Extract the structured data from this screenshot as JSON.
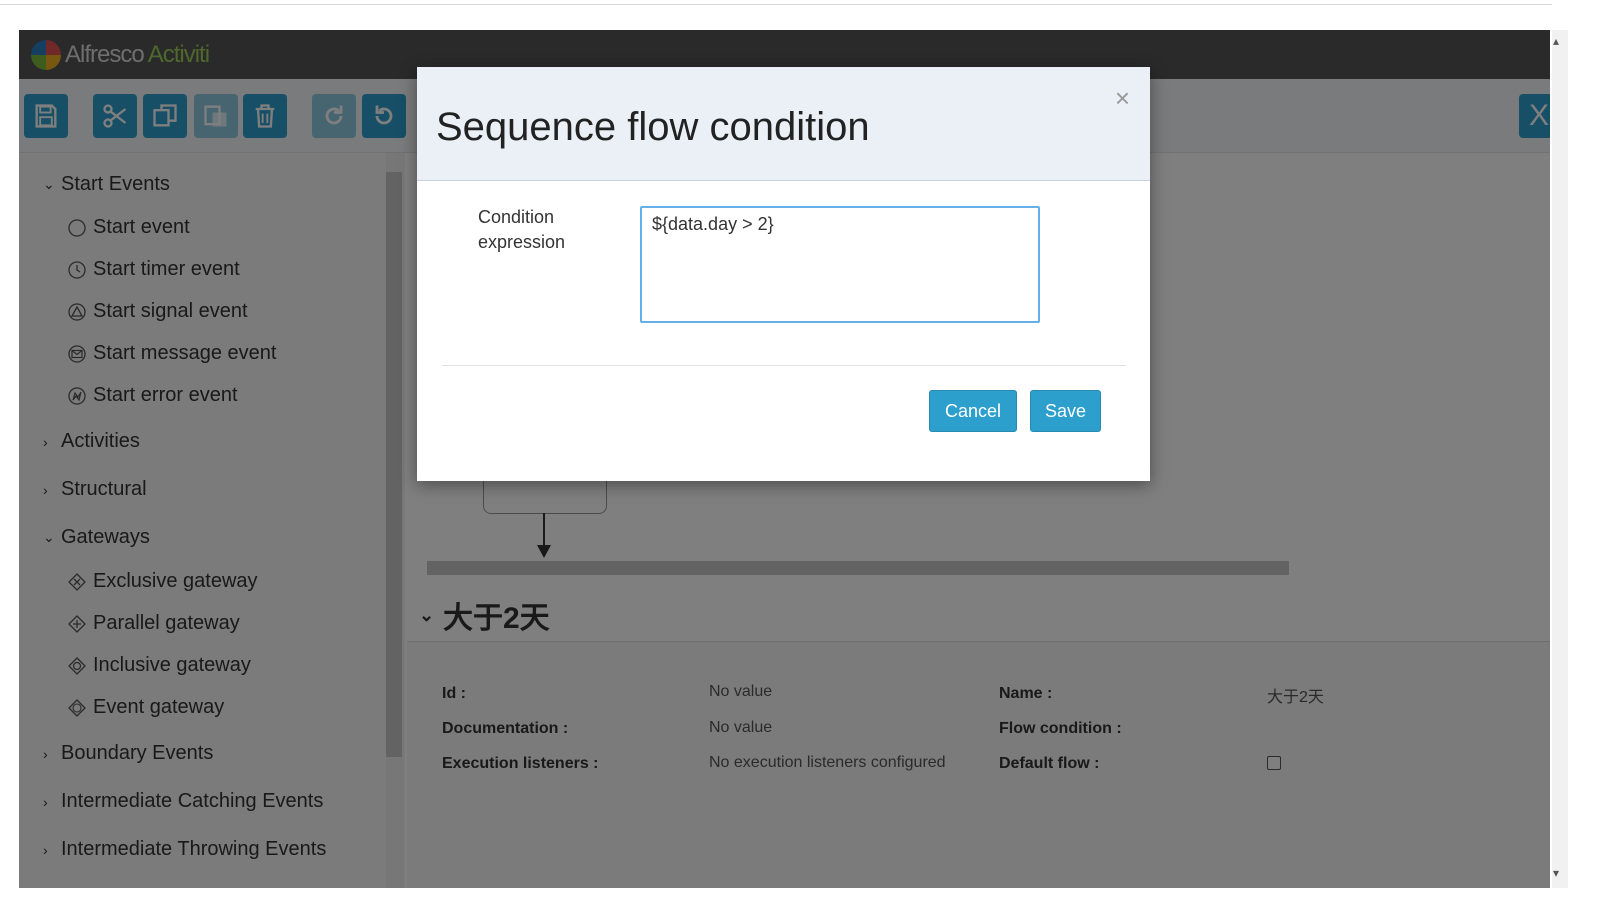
{
  "header": {
    "logo_text_1": "Alfresco",
    "logo_text_2": "Activiti"
  },
  "toolbar": {
    "buttons": [
      "save-icon",
      "cut-icon",
      "copy-icon",
      "paste-icon",
      "delete-icon",
      "redo-icon",
      "undo-icon"
    ],
    "right_button_label": "X"
  },
  "palette": {
    "groups": [
      {
        "label": "Start Events",
        "expanded": true,
        "items": [
          "Start event",
          "Start timer event",
          "Start signal event",
          "Start message event",
          "Start error event"
        ]
      },
      {
        "label": "Activities",
        "expanded": false
      },
      {
        "label": "Structural",
        "expanded": false
      },
      {
        "label": "Gateways",
        "expanded": true,
        "items": [
          "Exclusive gateway",
          "Parallel gateway",
          "Inclusive gateway",
          "Event gateway"
        ]
      },
      {
        "label": "Boundary Events",
        "expanded": false
      },
      {
        "label": "Intermediate Catching Events",
        "expanded": false
      },
      {
        "label": "Intermediate Throwing Events",
        "expanded": false
      }
    ]
  },
  "properties": {
    "title": "大于2天",
    "id_label": "Id :",
    "id_value": "No value",
    "documentation_label": "Documentation :",
    "documentation_value": "No value",
    "listeners_label": "Execution listeners :",
    "listeners_value": "No execution listeners configured",
    "name_label": "Name :",
    "name_value": "大于2天",
    "flow_condition_label": "Flow condition :",
    "default_flow_label": "Default flow :"
  },
  "modal": {
    "title": "Sequence flow condition",
    "close": "×",
    "condition_label": "Condition expression",
    "condition_value": "${data.day > 2}",
    "cancel_label": "Cancel",
    "save_label": "Save"
  },
  "colors": {
    "accent": "#2d9fcc",
    "header": "#545454",
    "modal_header": "#eaf0f5"
  }
}
